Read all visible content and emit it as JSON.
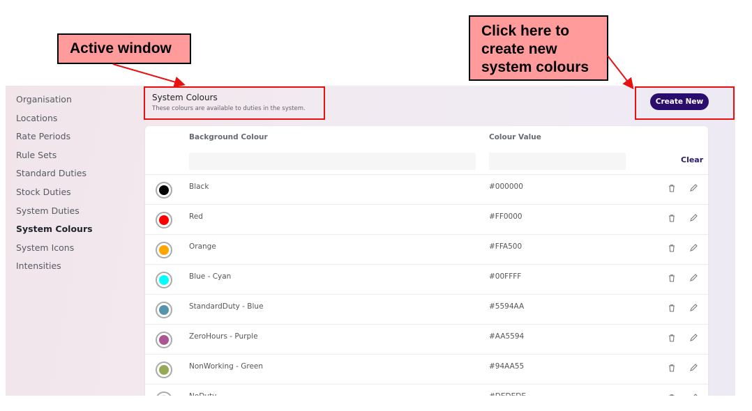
{
  "annotations": {
    "active_window": "Active window",
    "create_hint": [
      "Click here to",
      "create new",
      "system colours"
    ]
  },
  "sidebar": {
    "items": [
      {
        "label": "Organisation"
      },
      {
        "label": "Locations"
      },
      {
        "label": "Rate Periods"
      },
      {
        "label": "Rule Sets"
      },
      {
        "label": "Standard Duties"
      },
      {
        "label": "Stock Duties"
      },
      {
        "label": "System Duties"
      },
      {
        "label": "System Colours",
        "active": true
      },
      {
        "label": "System Icons"
      },
      {
        "label": "Intensities"
      }
    ]
  },
  "header": {
    "title": "System Colours",
    "subtitle": "These colours are available to duties in the system.",
    "create_label": "Create New"
  },
  "table": {
    "columns": {
      "background": "Background Colour",
      "value": "Colour Value"
    },
    "clear_label": "Clear",
    "filters": {
      "background": "",
      "value": ""
    },
    "rows": [
      {
        "name": "Black",
        "value": "#000000",
        "color": "#000000"
      },
      {
        "name": "Red",
        "value": "#FF0000",
        "color": "#FF0000"
      },
      {
        "name": "Orange",
        "value": "#FFA500",
        "color": "#FFA500"
      },
      {
        "name": "Blue - Cyan",
        "value": "#00FFFF",
        "color": "#00FFFF"
      },
      {
        "name": "StandardDuty - Blue",
        "value": "#5594AA",
        "color": "#5594AA"
      },
      {
        "name": "ZeroHours - Purple",
        "value": "#AA5594",
        "color": "#AA5594"
      },
      {
        "name": "NonWorking - Green",
        "value": "#94AA55",
        "color": "#94AA55"
      },
      {
        "name": "NoDuty",
        "value": "#DEDEDE",
        "color": "#DEDEDE"
      }
    ]
  },
  "colors": {
    "accent": "#2B0D6E",
    "annotation_fill": "#FF9B9B",
    "annotation_border": "#E81010"
  }
}
